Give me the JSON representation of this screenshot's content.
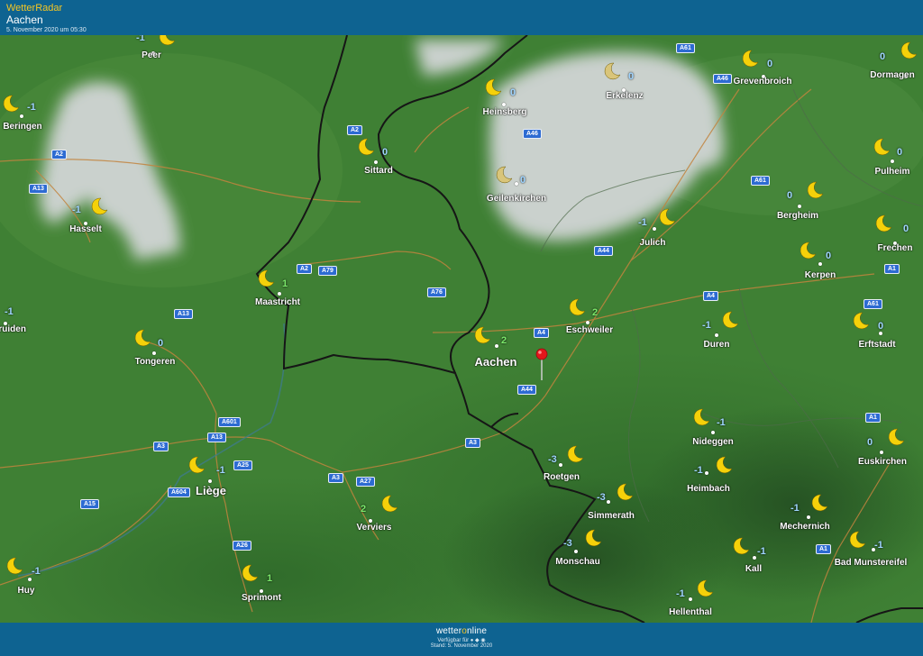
{
  "header": {
    "brand": "WetterRadar",
    "location": "Aachen",
    "datetime": "5. November 2020 um 05:30"
  },
  "footer": {
    "logo_a": "wetter",
    "logo_b": "o",
    "logo_c": "nline",
    "available": "Verfügbar für ● ◆ ◉",
    "stand": "Stand: 5. November 2020"
  },
  "colors": {
    "temp_positive": "#7be86a",
    "temp_negative": "#9fd4ff",
    "temp_zero": "#9fd4ff",
    "moon": "#f5d10a",
    "moon_cloudy": "#d9c57a"
  },
  "icons": {
    "weather": "crescent-moon-icon",
    "marker": "map-pin-icon"
  },
  "cities": [
    {
      "name": "Peer",
      "temp": "-1"
    },
    {
      "name": "Beringen",
      "temp": "-1"
    },
    {
      "name": "Hasselt",
      "temp": "-1"
    },
    {
      "name": "Sittard",
      "temp": "0"
    },
    {
      "name": "Heinsberg",
      "temp": "0"
    },
    {
      "name": "Erkelenz",
      "temp": "0"
    },
    {
      "name": "Grevenbroich",
      "temp": "0"
    },
    {
      "name": "Dormagen",
      "temp": "0"
    },
    {
      "name": "Geilenkirchen",
      "temp": "0"
    },
    {
      "name": "Pulheim",
      "temp": "0"
    },
    {
      "name": "Bergheim",
      "temp": "0"
    },
    {
      "name": "Julich",
      "temp": "-1"
    },
    {
      "name": "Frechen",
      "temp": "0"
    },
    {
      "name": "Kerpen",
      "temp": "0"
    },
    {
      "name": "Maastricht",
      "temp": "1"
    },
    {
      "name": "truiden",
      "temp": "-1"
    },
    {
      "name": "Tongeren",
      "temp": "0"
    },
    {
      "name": "Aachen",
      "temp": "2"
    },
    {
      "name": "Eschweiler",
      "temp": "2"
    },
    {
      "name": "Duren",
      "temp": "-1"
    },
    {
      "name": "Erftstadt",
      "temp": "0"
    },
    {
      "name": "Nideggen",
      "temp": "-1"
    },
    {
      "name": "Euskirchen",
      "temp": "0"
    },
    {
      "name": "Liège",
      "temp": "-1"
    },
    {
      "name": "Roetgen",
      "temp": "-3"
    },
    {
      "name": "Heimbach",
      "temp": "-1"
    },
    {
      "name": "Verviers",
      "temp": "2"
    },
    {
      "name": "Simmerath",
      "temp": "-3"
    },
    {
      "name": "Mechernich",
      "temp": "-1"
    },
    {
      "name": "Monschau",
      "temp": "-3"
    },
    {
      "name": "Kall",
      "temp": "-1"
    },
    {
      "name": "Bad Munstereifel",
      "temp": "-1"
    },
    {
      "name": "Huy",
      "temp": "-1"
    },
    {
      "name": "Sprimont",
      "temp": "1"
    },
    {
      "name": "Hellenthal",
      "temp": "-1"
    }
  ],
  "roads": [
    "A61",
    "A46",
    "A2",
    "A46",
    "A2",
    "A13",
    "A61",
    "A44",
    "A2",
    "A79",
    "A76",
    "A1",
    "A4",
    "A61",
    "A13",
    "A4",
    "A44",
    "A601",
    "A13",
    "A3",
    "A25",
    "A3",
    "A3",
    "A27",
    "A1",
    "A604",
    "A15",
    "A26",
    "A1"
  ]
}
